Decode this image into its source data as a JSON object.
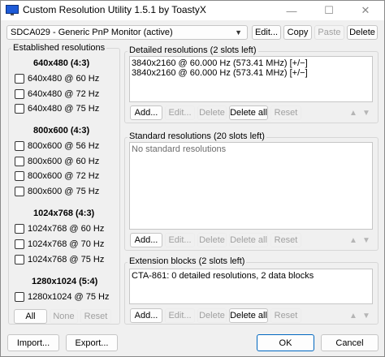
{
  "window": {
    "title": "Custom Resolution Utility 1.5.1 by ToastyX",
    "minimize_glyph": "—",
    "maximize_glyph": "☐",
    "close_glyph": "✕"
  },
  "monitor": {
    "selected": "SDCA029 - Generic PnP Monitor (active)",
    "edit_label": "Edit...",
    "copy_label": "Copy",
    "paste_label": "Paste",
    "delete_label": "Delete"
  },
  "established": {
    "label": "Established resolutions",
    "sections": [
      {
        "title": "640x480 (4:3)",
        "items": [
          "640x480 @ 60 Hz",
          "640x480 @ 72 Hz",
          "640x480 @ 75 Hz"
        ]
      },
      {
        "title": "800x600 (4:3)",
        "items": [
          "800x600 @ 56 Hz",
          "800x600 @ 60 Hz",
          "800x600 @ 72 Hz",
          "800x600 @ 75 Hz"
        ]
      },
      {
        "title": "1024x768 (4:3)",
        "items": [
          "1024x768 @ 60 Hz",
          "1024x768 @ 70 Hz",
          "1024x768 @ 75 Hz"
        ]
      },
      {
        "title": "1280x1024 (5:4)",
        "items": [
          "1280x1024 @ 75 Hz"
        ]
      }
    ],
    "all_label": "All",
    "none_label": "None",
    "reset_label": "Reset"
  },
  "detailed": {
    "label": "Detailed resolutions (2 slots left)",
    "items": [
      "3840x2160 @ 60.000 Hz (573.41 MHz) [+/−]",
      "3840x2160 @ 60.000 Hz (573.41 MHz) [+/−]"
    ],
    "add_label": "Add...",
    "edit_label": "Edit...",
    "delete_label": "Delete",
    "delete_all_label": "Delete all",
    "reset_label": "Reset"
  },
  "standard": {
    "label": "Standard resolutions (20 slots left)",
    "empty_text": "No standard resolutions",
    "add_label": "Add...",
    "edit_label": "Edit...",
    "delete_label": "Delete",
    "delete_all_label": "Delete all",
    "reset_label": "Reset"
  },
  "extension": {
    "label": "Extension blocks (2 slots left)",
    "items": [
      "CTA-861: 0 detailed resolutions, 2 data blocks"
    ],
    "add_label": "Add...",
    "edit_label": "Edit...",
    "delete_label": "Delete",
    "delete_all_label": "Delete all",
    "reset_label": "Reset"
  },
  "footer": {
    "import_label": "Import...",
    "export_label": "Export...",
    "ok_label": "OK",
    "cancel_label": "Cancel"
  },
  "icons": {
    "up": "▲",
    "down": "▼",
    "chevron": "▼"
  }
}
